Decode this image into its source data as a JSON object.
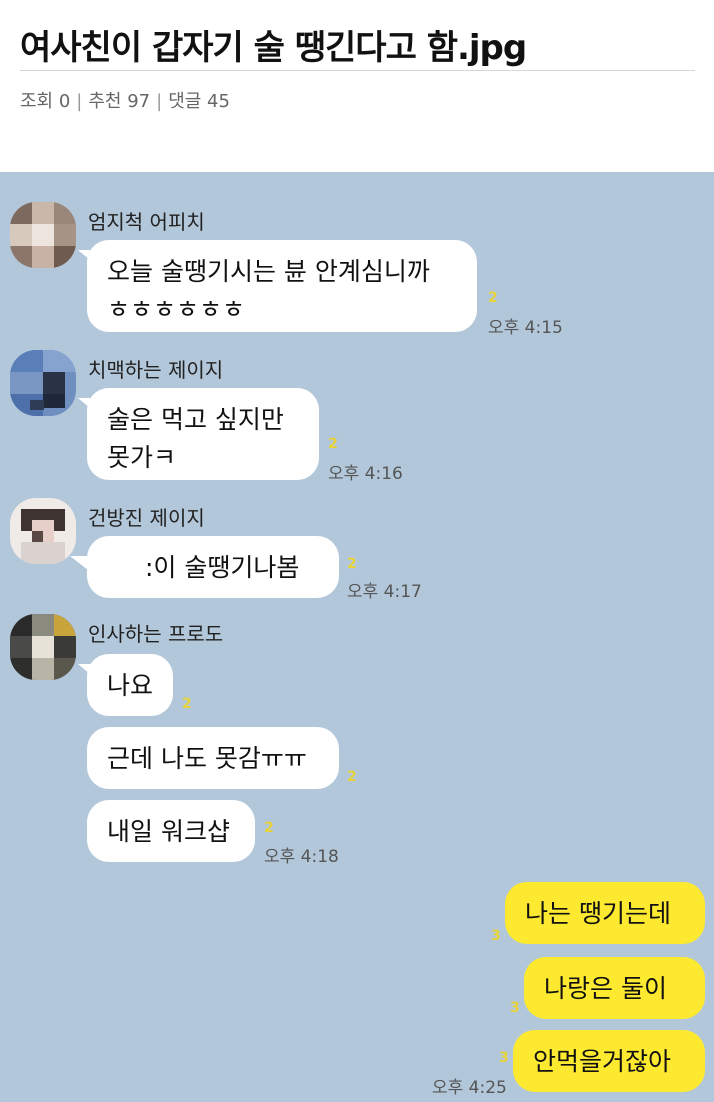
{
  "post": {
    "title": "여사친이 갑자기 술 땡긴다고 함.jpg",
    "views_label": "조회 0",
    "recommend_label": "추천 97",
    "comments_label": "댓글 45",
    "separator": "|"
  },
  "chat": {
    "background": "#b2c7da",
    "bubble_color": "#ffffff",
    "my_bubble_color": "#fde92f",
    "messages": [
      {
        "sender": "엄지척 어피치",
        "line1": "오늘 술땡기시는 뷴 안계심니까",
        "line2": "ㅎㅎㅎㅎㅎㅎ",
        "unread": "2",
        "time": "오후 4:15"
      },
      {
        "sender": "치맥하는 제이지",
        "line1": "술은 먹고 싶지만",
        "line2": "못가ㅋ",
        "unread": "2",
        "time": "오후 4:16"
      },
      {
        "sender": "건방진 제이지",
        "line1": ":이 술땡기나봄",
        "unread": "2",
        "time": "오후 4:17"
      },
      {
        "sender": "인사하는 프로도",
        "bubbles": [
          "나요",
          "근데 나도 못감ㅠㅠ",
          "내일 워크샵"
        ],
        "unread": [
          "2",
          "2",
          "2"
        ],
        "time": "오후 4:18"
      }
    ],
    "my_messages": [
      "나는 땡기는데",
      "나랑은 둘이",
      "안먹을거잖아"
    ],
    "my_unread": [
      "3",
      "3",
      "3"
    ],
    "my_time": "오후 4:25"
  }
}
